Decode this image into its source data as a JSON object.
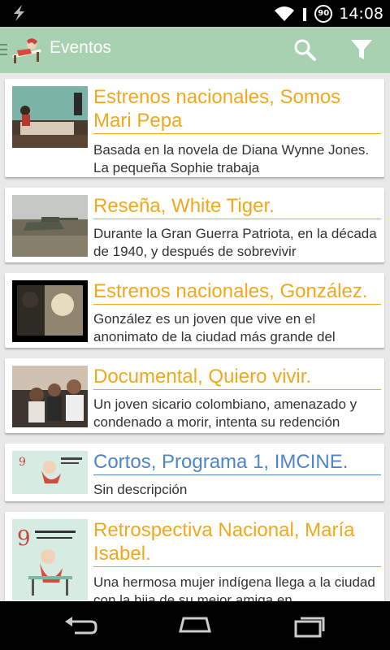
{
  "status_bar": {
    "time": "14:08",
    "battery_level": "90",
    "icons": [
      "lightning-icon",
      "wifi-icon",
      "signal-icon",
      "battery-icon"
    ]
  },
  "action_bar": {
    "title": "Eventos",
    "background_color": "#a7d1b0",
    "icons": [
      "drawer-indicator-icon",
      "app-logo",
      "search-icon",
      "filter-icon"
    ]
  },
  "events": [
    {
      "title": "Estrenos nacionales, Somos Mari Pepa",
      "description": "Basada en la novela de Diana Wynne Jones. La pequeña Sophie trabaja",
      "title_color": "#f2a81d"
    },
    {
      "title": "Reseña, White Tiger.",
      "description": "Durante la Gran Guerra Patriota, en la década de 1940, y después de sobrevivir",
      "title_color": "#f2a81d"
    },
    {
      "title": "Estrenos nacionales, González.",
      "description": "González es un joven que vive en el anonimato de la ciudad más grande del",
      "title_color": "#f2a81d"
    },
    {
      "title": "Documental, Quiero vivir.",
      "description": "Un joven sicario colombiano, amenazado y condenado a morir, intenta su redención",
      "title_color": "#f2a81d"
    },
    {
      "title": "Cortos, Programa 1, IMCINE.",
      "description": "Sin descripción",
      "title_color": "#4e86c6"
    },
    {
      "title": "Retrospectiva Nacional, María Isabel.",
      "description": "Una hermosa mujer indígena llega a la ciudad con la hija de su mejor amiga en",
      "title_color": "#f2a81d"
    }
  ],
  "nav_bar": {
    "icons": [
      "back-icon",
      "home-icon",
      "recents-icon"
    ]
  }
}
